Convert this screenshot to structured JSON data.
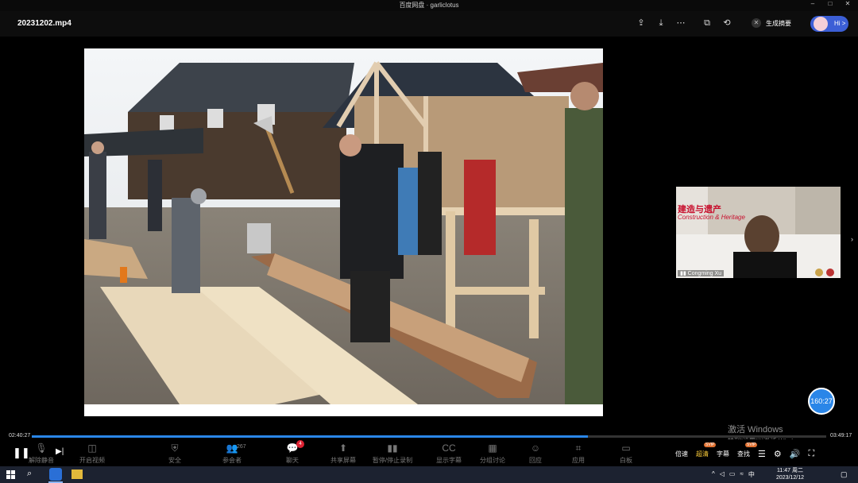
{
  "window": {
    "title": "百度网盘 · garliclotus"
  },
  "header": {
    "filename": "20231202.mp4",
    "icons": [
      "share-icon",
      "download-icon",
      "more-icon",
      "pip-icon",
      "rotate-icon"
    ],
    "summary_label": "生成摘要",
    "hi_label": "Hi >"
  },
  "pip": {
    "banner_cn": "建造与遗产",
    "banner_en": "Construction & Heritage",
    "speaker_name": "Congming Xu"
  },
  "player": {
    "elapsed": "02:40:27",
    "total": "03:49:17",
    "progress": 0.7,
    "timer_badge": "160:27"
  },
  "watermark": {
    "line1": "激活 Windows",
    "line2": "转到\"设置\"以激活 Windows。"
  },
  "controls": {
    "zoom_tools": [
      {
        "icon": "mic-off-icon",
        "label": "解除静音"
      },
      {
        "icon": "video-off-icon",
        "label": "开启视频"
      },
      {
        "icon": "shield-icon",
        "label": "安全"
      },
      {
        "icon": "participants-icon",
        "label": "参会者",
        "count": "267"
      },
      {
        "icon": "chat-icon",
        "label": "聊天",
        "badge": "4"
      },
      {
        "icon": "share-screen-icon",
        "label": "共享屏幕"
      },
      {
        "icon": "record-icon",
        "label": "暂停/停止录制"
      },
      {
        "icon": "cc-icon",
        "label": "显示字幕"
      },
      {
        "icon": "breakout-icon",
        "label": "分组讨论"
      },
      {
        "icon": "reactions-icon",
        "label": "回应"
      },
      {
        "icon": "apps-icon",
        "label": "应用"
      },
      {
        "icon": "whiteboard-icon",
        "label": "白板"
      }
    ],
    "right_tools": [
      {
        "label": "倍速",
        "highlight": false
      },
      {
        "label": "超清",
        "highlight": true,
        "svip": "SVIP"
      },
      {
        "label": "字幕",
        "highlight": false
      },
      {
        "label": "查找",
        "highlight": false,
        "svip": "SVIP"
      }
    ]
  },
  "taskbar": {
    "tray_lang": "中",
    "time": "11:47 周二",
    "date": "2023/12/12"
  }
}
